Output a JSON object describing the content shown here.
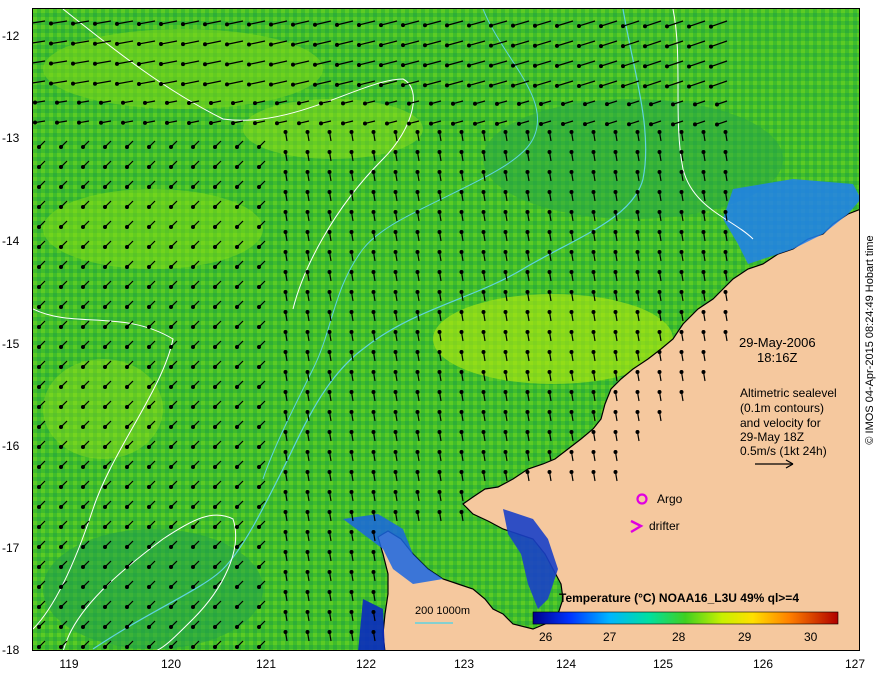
{
  "map": {
    "axis": {
      "lat_labels": [
        "-12",
        "-13",
        "-14",
        "-15",
        "-16",
        "-17",
        "-18"
      ],
      "lon_labels": [
        "119",
        "120",
        "121",
        "122",
        "123",
        "124",
        "125",
        "126",
        "127"
      ]
    },
    "date_line": "29-May-2006",
    "time_line": "18:16Z",
    "info_lines": [
      "Altimetric sealevel",
      "(0.1m contours)",
      "and velocity for",
      "29-May 18Z",
      "0.5m/s (1kt 24h)"
    ],
    "argo_label": "Argo",
    "drifter_label": "drifter",
    "depth_legend": "200  1000m",
    "colorbar": {
      "title": "Temperature (°C) NOAA16_L3U 49% ql>=4",
      "ticks": [
        "26",
        "27",
        "28",
        "29",
        "30"
      ]
    },
    "credit": "© IMOS 04-Apr-2015 08:24:49 Hobart time",
    "colors": {
      "land": "#f5c89e",
      "sea_base": "#3fbd2b",
      "contour": "#ffffff",
      "bathymetry": "#5fd3e0",
      "argo_marker": "#e000e0",
      "drifter_marker": "#e000e0"
    }
  }
}
